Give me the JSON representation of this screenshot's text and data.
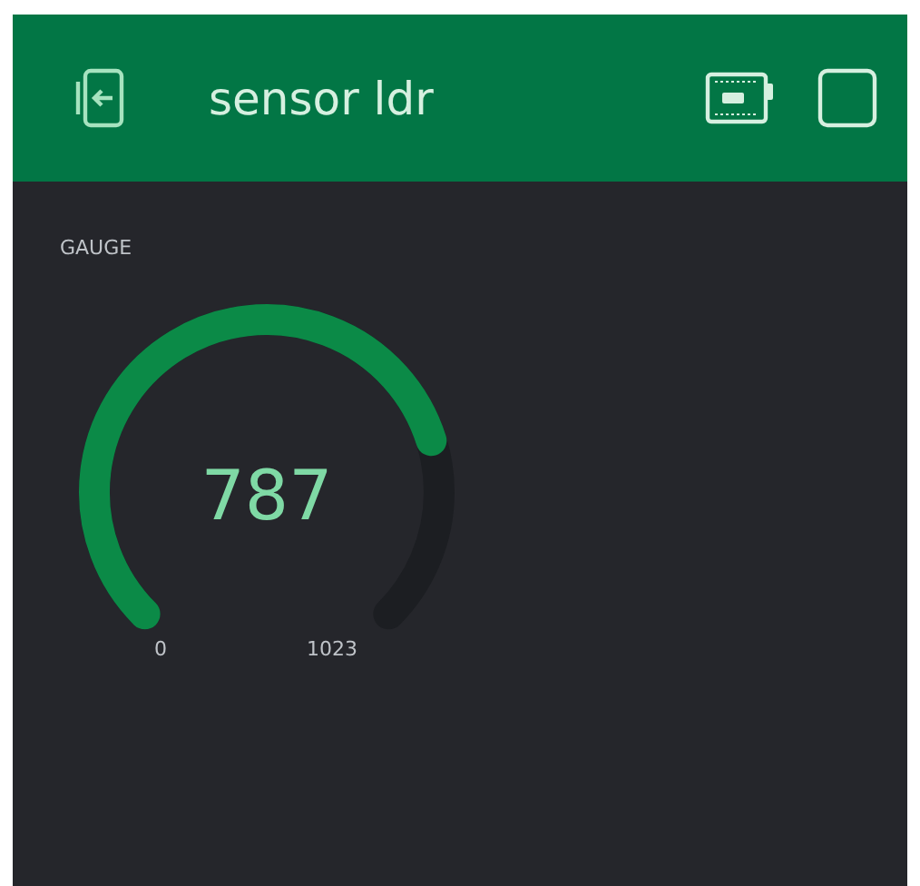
{
  "header": {
    "title": "sensor ldr"
  },
  "gauge": {
    "label": "GAUGE",
    "value": "787",
    "min": "0",
    "max": "1023"
  }
}
